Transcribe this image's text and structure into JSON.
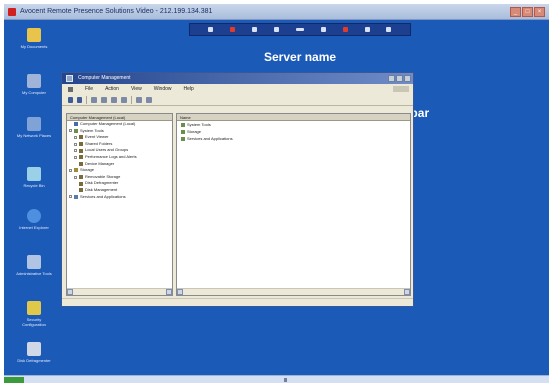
{
  "viewer": {
    "title": "Avocent Remote Presence Solutions Video - 212.199.134.381"
  },
  "remote_toolbar": {
    "buttons": [
      "toolbar-button-1",
      "toolbar-button-2",
      "toolbar-button-3",
      "toolbar-button-4",
      "toolbar-button-5",
      "toolbar-button-6",
      "toolbar-button-7",
      "toolbar-button-8",
      "toolbar-button-9"
    ]
  },
  "callouts": {
    "server_name": "Server name",
    "toolbar": "Toolbar"
  },
  "desktop_icons": [
    {
      "label": "My Documents",
      "icon": "folder-icon",
      "color": "#e8c44a"
    },
    {
      "label": "My Computer",
      "icon": "computer-icon",
      "color": "#9fb4d8"
    },
    {
      "label": "My Network Places",
      "icon": "network-icon",
      "color": "#7fa3d6"
    },
    {
      "label": "Recycle Bin",
      "icon": "recycle-bin-icon",
      "color": "#9ad0e8"
    },
    {
      "label": "Internet Explorer",
      "icon": "browser-icon",
      "color": "#4f8fe0"
    },
    {
      "label": "Administrative Tools",
      "icon": "tools-icon",
      "color": "#b0c4e4"
    },
    {
      "label": "Security Configuration",
      "icon": "key-icon",
      "color": "#e0c84a"
    },
    {
      "label": "Disk Defragmenter",
      "icon": "disk-icon",
      "color": "#d0d8e8"
    }
  ],
  "cm_window": {
    "title": "Computer Management",
    "menu": [
      "File",
      "Action",
      "View",
      "Window",
      "Help"
    ],
    "tree_header": "Computer Management (Local)",
    "tree": [
      {
        "label": "Computer Management (Local)",
        "level": 0,
        "expander": false,
        "icon": "computer-icon"
      },
      {
        "label": "System Tools",
        "level": 0,
        "expander": true,
        "icon": "tools-icon"
      },
      {
        "label": "Event Viewer",
        "level": 1,
        "expander": true,
        "icon": "event-viewer-icon"
      },
      {
        "label": "Shared Folders",
        "level": 1,
        "expander": true,
        "icon": "shared-folder-icon"
      },
      {
        "label": "Local Users and Groups",
        "level": 1,
        "expander": true,
        "icon": "users-icon"
      },
      {
        "label": "Performance Logs and Alerts",
        "level": 1,
        "expander": true,
        "icon": "performance-icon"
      },
      {
        "label": "Device Manager",
        "level": 1,
        "expander": false,
        "icon": "device-manager-icon"
      },
      {
        "label": "Storage",
        "level": 0,
        "expander": true,
        "icon": "storage-icon"
      },
      {
        "label": "Removable Storage",
        "level": 1,
        "expander": true,
        "icon": "removable-storage-icon"
      },
      {
        "label": "Disk Defragmenter",
        "level": 1,
        "expander": false,
        "icon": "defrag-icon"
      },
      {
        "label": "Disk Management",
        "level": 1,
        "expander": false,
        "icon": "disk-management-icon"
      },
      {
        "label": "Services and Applications",
        "level": 0,
        "expander": true,
        "icon": "services-icon"
      }
    ],
    "detail_header": "Name",
    "detail_items": [
      "System Tools",
      "Storage",
      "Services and Applications"
    ]
  }
}
